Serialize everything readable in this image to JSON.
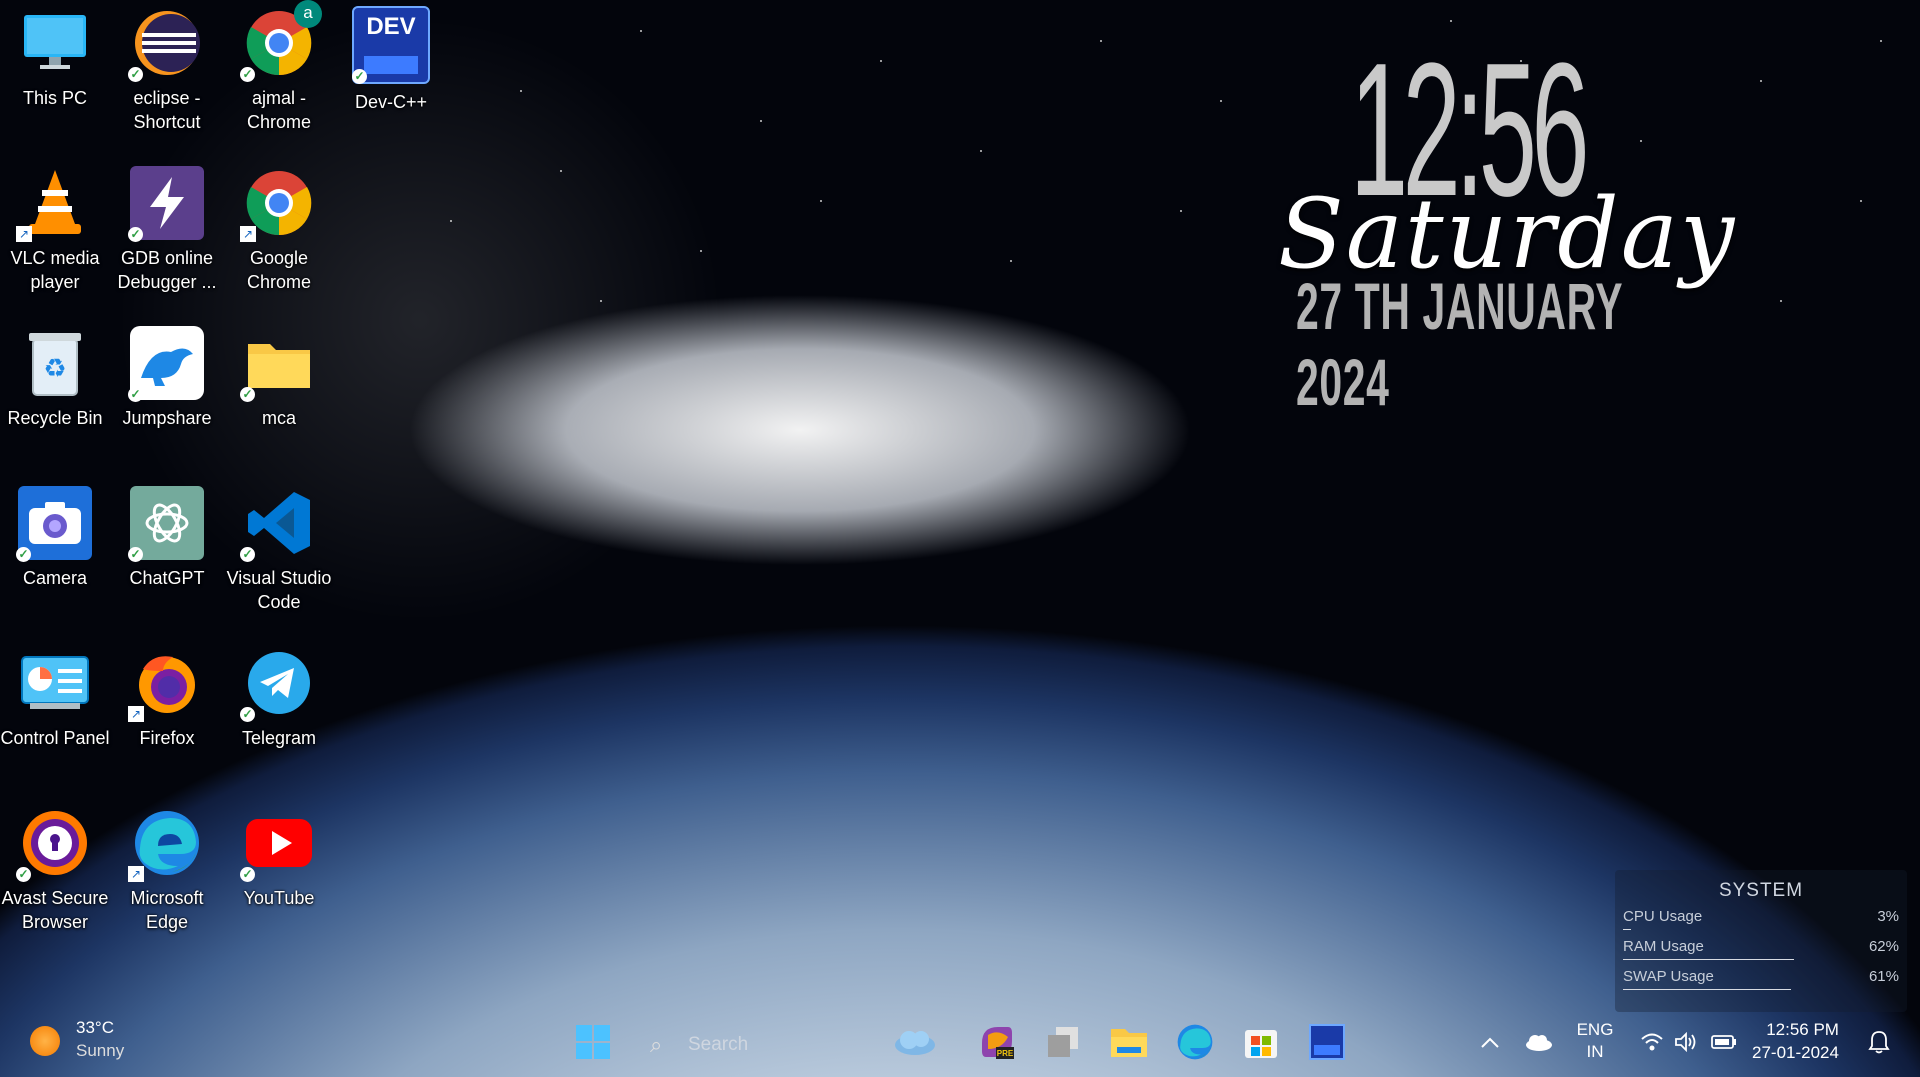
{
  "desktop": {
    "icons": [
      {
        "label": "This PC",
        "icon": "this-pc-icon"
      },
      {
        "label": "eclipse - Shortcut",
        "icon": "eclipse-icon"
      },
      {
        "label": "ajmal - Chrome",
        "icon": "chrome-profile-icon",
        "profile_letter": "a"
      },
      {
        "label": "Dev-C++",
        "icon": "devcpp-icon",
        "icon_text": "DEV"
      },
      {
        "label": "VLC media player",
        "icon": "vlc-icon"
      },
      {
        "label": "GDB online Debugger ...",
        "icon": "gdb-icon"
      },
      {
        "label": "Google Chrome",
        "icon": "chrome-icon"
      },
      {
        "label": "Recycle Bin",
        "icon": "recycle-bin-icon"
      },
      {
        "label": "Jumpshare",
        "icon": "jumpshare-icon"
      },
      {
        "label": "mca",
        "icon": "folder-icon"
      },
      {
        "label": "Camera",
        "icon": "camera-icon"
      },
      {
        "label": "ChatGPT",
        "icon": "chatgpt-icon"
      },
      {
        "label": "Visual Studio Code",
        "icon": "vscode-icon"
      },
      {
        "label": "Control Panel",
        "icon": "control-panel-icon"
      },
      {
        "label": "Firefox",
        "icon": "firefox-icon"
      },
      {
        "label": "Telegram",
        "icon": "telegram-icon"
      },
      {
        "label": "Avast Secure Browser",
        "icon": "avast-browser-icon"
      },
      {
        "label": "Microsoft Edge",
        "icon": "edge-icon"
      },
      {
        "label": "YouTube",
        "icon": "youtube-icon"
      }
    ]
  },
  "clock_widget": {
    "time": "12:56",
    "day": "Saturday",
    "date": "27 TH JANUARY 2024"
  },
  "system_monitor": {
    "title": "SYSTEM",
    "rows": [
      {
        "name": "CPU Usage",
        "value": "3%",
        "level": 0.03
      },
      {
        "name": "RAM Usage",
        "value": "62%",
        "level": 0.62
      },
      {
        "name": "SWAP Usage",
        "value": "61%",
        "level": 0.61
      }
    ]
  },
  "taskbar": {
    "weather": {
      "temp": "33°C",
      "desc": "Sunny"
    },
    "search_placeholder": "Search",
    "pinned": [
      "start-icon",
      "weather-app-icon",
      "copilot-icon",
      "task-view-icon",
      "file-explorer-icon",
      "edge-icon",
      "store-icon",
      "devcpp-icon"
    ],
    "tray": {
      "lang_top": "ENG",
      "lang_bottom": "IN",
      "time": "12:56 PM",
      "date": "27-01-2024"
    }
  },
  "colors": {
    "space": "#03050c",
    "clock_grey": "#c9c9c9",
    "accent_green": "#2f9e44"
  }
}
